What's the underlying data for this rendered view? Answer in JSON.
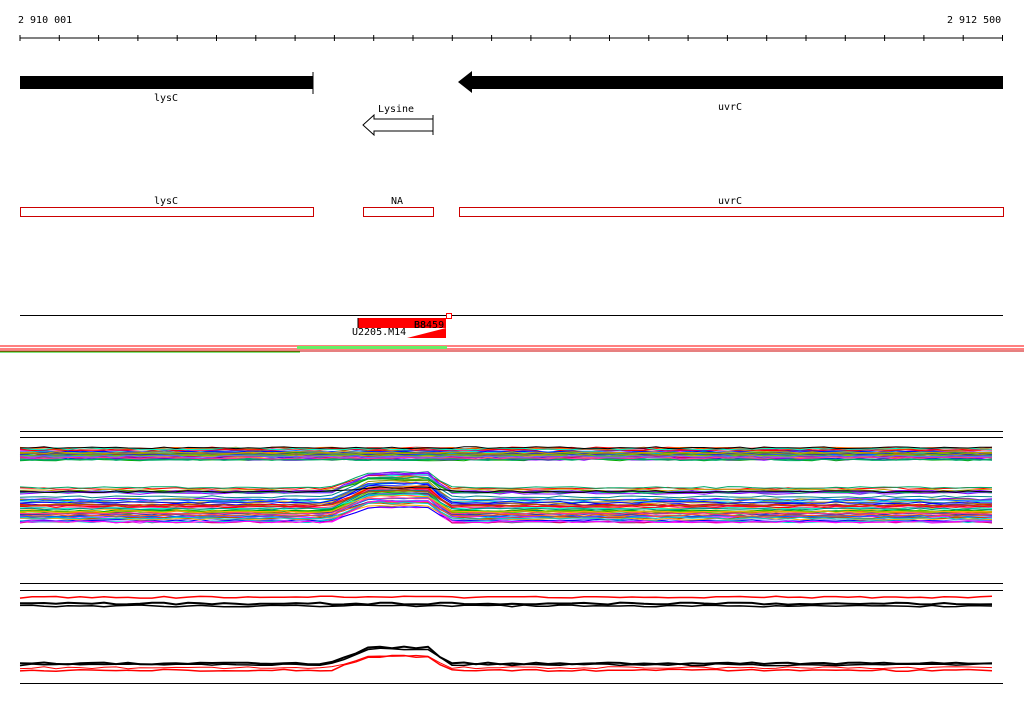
{
  "ruler": {
    "start_label": "2 910 001",
    "end_label": "2 912 500"
  },
  "genes": [
    {
      "name": "lysC",
      "strand": "reverse"
    },
    {
      "name": "uvrC",
      "strand": "reverse"
    }
  ],
  "riboswitch": {
    "name": "Lysine",
    "strand": "reverse"
  },
  "regions": [
    {
      "name": "lysC"
    },
    {
      "name": "NA"
    },
    {
      "name": "uvrC"
    }
  ],
  "features": {
    "feature_a_label": "U2205.M14",
    "feature_b_label": "B8459",
    "feature_c_label": "B8"
  },
  "colors": {
    "gene_fill": "#000000",
    "region_outline": "#cc0000",
    "feature_red": "#ff0000",
    "coverage_green": "#00cc00"
  }
}
